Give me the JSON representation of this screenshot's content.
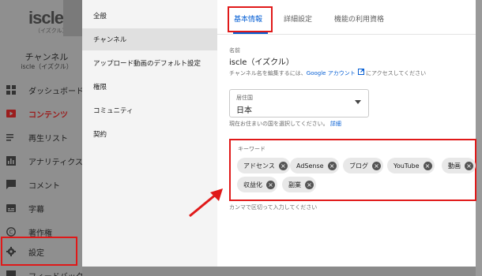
{
  "sidebar": {
    "logo_text": "iscle",
    "logo_sub": "（イズクル）",
    "channel_title": "チャンネル",
    "channel_subtitle": "iscle（イズクル）",
    "items": [
      {
        "label": "ダッシュボード",
        "icon": "dashboard-icon"
      },
      {
        "label": "コンテンツ",
        "icon": "content-icon",
        "active": true
      },
      {
        "label": "再生リスト",
        "icon": "playlist-icon"
      },
      {
        "label": "アナリティクス",
        "icon": "analytics-icon"
      },
      {
        "label": "コメント",
        "icon": "comment-icon"
      },
      {
        "label": "字幕",
        "icon": "subtitles-icon"
      },
      {
        "label": "著作権",
        "icon": "copyright-icon"
      },
      {
        "label": "設定",
        "icon": "gear-icon"
      },
      {
        "label": "フィードバックを送信",
        "icon": "feedback-icon"
      }
    ]
  },
  "settings_nav": {
    "items": [
      {
        "label": "全般"
      },
      {
        "label": "チャンネル",
        "active": true
      },
      {
        "label": "アップロード動画のデフォルト設定"
      },
      {
        "label": "権限"
      },
      {
        "label": "コミュニティ"
      },
      {
        "label": "契約"
      }
    ]
  },
  "tabs": [
    {
      "label": "基本情報",
      "active": true
    },
    {
      "label": "詳細設定"
    },
    {
      "label": "機能の利用資格"
    }
  ],
  "name_field": {
    "label": "名前",
    "value": "iscle（イズクル）",
    "help_prefix": "チャンネル名を編集するには、",
    "help_link": "Google アカウント",
    "help_suffix": " にアクセスしてください"
  },
  "country_field": {
    "label": "居住国",
    "value": "日本",
    "help": "現在お住まいの国を選択してください。",
    "help_link": "詳細"
  },
  "keywords_field": {
    "label": "キーワード",
    "chips": [
      "アドセンス",
      "AdSense",
      "ブログ",
      "YouTube",
      "動画",
      "収益化",
      "副業"
    ],
    "help": "カンマで区切って入力してください"
  },
  "colors": {
    "accent": "#065fd4",
    "highlight": "#e01919",
    "active_nav": "#9b1d1d"
  }
}
